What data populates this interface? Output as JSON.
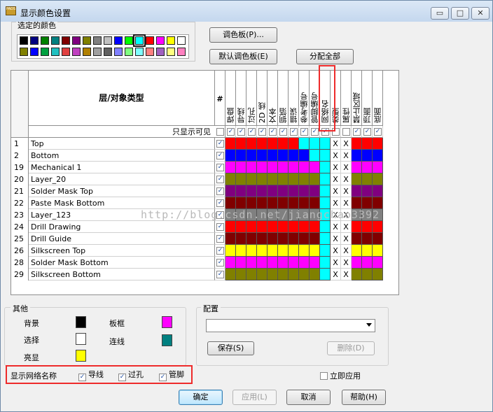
{
  "window": {
    "title": "显示颜色设置",
    "logo_text": "PADS"
  },
  "selected_colors": {
    "label": "选定的颜色",
    "row1": [
      "#000000",
      "#000080",
      "#008000",
      "#008080",
      "#800000",
      "#800080",
      "#808000",
      "#808080",
      "#c0c0c0",
      "#0000ff",
      "#00ff00",
      "#00ffff",
      "#ff0000",
      "#ff00ff",
      "#ffff00",
      "#ffffff"
    ],
    "row2": [
      "#808000",
      "#0000ff",
      "#00a040",
      "#20c0c0",
      "#e04040",
      "#c040c0",
      "#b08000",
      "#a0a0a0",
      "#606060",
      "#8080ff",
      "#80ff80",
      "#80ffff",
      "#ff8080",
      "#a060c0",
      "#ffff80",
      "#ff80c0"
    ],
    "selected_index": 11
  },
  "buttons": {
    "palette": "调色板(P)...",
    "default_palette": "默认调色板(E)",
    "assign_all": "分配全部",
    "save": "保存(S)",
    "delete": "删除(D)",
    "ok": "确定",
    "apply": "应用(L)",
    "cancel": "取消",
    "help": "帮助(H)"
  },
  "grid": {
    "layer_type_header": "层/对象类型",
    "hash_header": "#",
    "visible_only_label": "只显示可见",
    "columns": [
      "焊盘",
      "导线",
      "过孔",
      "2D 线",
      "文本",
      "铜箔",
      "错误",
      "参考编号",
      "管脚编号",
      "网络名",
      "类型",
      "属性",
      "禁止区域",
      "顶面",
      "底面"
    ],
    "rows": [
      {
        "num": "1",
        "name": "Top",
        "colors": [
          "#ff0000",
          "#ff0000",
          "#ff0000",
          "#ff0000",
          "#ff0000",
          "#ff0000",
          "#ff0000",
          "#00ffff",
          "#00ffff",
          "#00ffff",
          "X",
          "X",
          "#ff0000",
          "#ff0000",
          "#ff0000"
        ]
      },
      {
        "num": "2",
        "name": "Bottom",
        "colors": [
          "#0000ff",
          "#0000ff",
          "#0000ff",
          "#0000ff",
          "#0000ff",
          "#0000ff",
          "#0000ff",
          "#0000ff",
          "#00ffff",
          "#00ffff",
          "X",
          "X",
          "#0000ff",
          "#0000ff",
          "#0000ff"
        ]
      },
      {
        "num": "19",
        "name": "Mechanical 1",
        "colors": [
          "#ff00ff",
          "#ff00ff",
          "#ff00ff",
          "#ff00ff",
          "#ff00ff",
          "#ff00ff",
          "#ff00ff",
          "#ff00ff",
          "#ff00ff",
          "#00ffff",
          "X",
          "X",
          "#ff00ff",
          "#ff00ff",
          "#ff00ff"
        ]
      },
      {
        "num": "20",
        "name": "Layer_20",
        "colors": [
          "#808000",
          "#808000",
          "#808000",
          "#808000",
          "#808000",
          "#808000",
          "#808000",
          "#808000",
          "#808000",
          "#00ffff",
          "X",
          "X",
          "#808000",
          "#808000",
          "#808000"
        ]
      },
      {
        "num": "21",
        "name": "Solder Mask Top",
        "colors": [
          "#800080",
          "#800080",
          "#800080",
          "#800080",
          "#800080",
          "#800080",
          "#800080",
          "#800080",
          "#800080",
          "#00ffff",
          "X",
          "X",
          "#800080",
          "#800080",
          "#800080"
        ]
      },
      {
        "num": "22",
        "name": "Paste Mask Bottom",
        "colors": [
          "#800000",
          "#800000",
          "#800000",
          "#800000",
          "#800000",
          "#800000",
          "#800000",
          "#800000",
          "#800000",
          "#00ffff",
          "X",
          "X",
          "#800000",
          "#800000",
          "#800000"
        ]
      },
      {
        "num": "23",
        "name": "Layer_123",
        "colors": [
          "#808080",
          "#808080",
          "#808080",
          "#808080",
          "#808080",
          "#808080",
          "#808080",
          "#808080",
          "#808080",
          "#00ffff",
          "X",
          "X",
          "#808080",
          "#808080",
          "#808080"
        ]
      },
      {
        "num": "24",
        "name": "Drill Drawing",
        "colors": [
          "#ff0000",
          "#ff0000",
          "#ff0000",
          "#ff0000",
          "#ff0000",
          "#ff0000",
          "#ff0000",
          "#ff0000",
          "#ff0000",
          "#00ffff",
          "X",
          "X",
          "#ff0000",
          "#ff0000",
          "#ff0000"
        ]
      },
      {
        "num": "25",
        "name": "Drill Guide",
        "colors": [
          "#800000",
          "#800000",
          "#800000",
          "#800000",
          "#800000",
          "#800000",
          "#800000",
          "#800000",
          "#800000",
          "#00ffff",
          "X",
          "X",
          "#800000",
          "#800000",
          "#800000"
        ]
      },
      {
        "num": "26",
        "name": "Silkscreen Top",
        "colors": [
          "#ffff00",
          "#ffff00",
          "#ffff00",
          "#ffff00",
          "#ffff00",
          "#ffff00",
          "#ffff00",
          "#ffff00",
          "#ffff00",
          "#00ffff",
          "X",
          "X",
          "#ffff00",
          "#ffff00",
          "#ffff00"
        ]
      },
      {
        "num": "28",
        "name": "Solder Mask Bottom",
        "colors": [
          "#ff00ff",
          "#ff00ff",
          "#ff00ff",
          "#ff00ff",
          "#ff00ff",
          "#ff00ff",
          "#ff00ff",
          "#ff00ff",
          "#ff00ff",
          "#00ffff",
          "X",
          "X",
          "#ff00ff",
          "#ff00ff",
          "#ff00ff"
        ]
      },
      {
        "num": "29",
        "name": "Silkscreen Bottom",
        "colors": [
          "#808000",
          "#808000",
          "#808000",
          "#808000",
          "#808000",
          "#808000",
          "#808000",
          "#808000",
          "#808000",
          "#00ffff",
          "X",
          "X",
          "#808000",
          "#808000",
          "#808000"
        ]
      }
    ]
  },
  "watermark": "http://blog.csdn.net/jiangchao3392",
  "other": {
    "label": "其他",
    "background_label": "背景",
    "background_color": "#000000",
    "board_frame_label": "板框",
    "board_frame_color": "#ff00ff",
    "selection_label": "选择",
    "selection_color": "#ffffff",
    "connection_label": "连线",
    "connection_color": "#008080",
    "highlight_label": "亮显",
    "highlight_color": "#ffff00"
  },
  "config": {
    "label": "配置",
    "selected_value": ""
  },
  "net_names": {
    "label": "显示网络名称",
    "traces": "导线",
    "vias": "过孔",
    "pins": "管脚"
  },
  "apply_immediately": "立即应用",
  "check_mark": "✓"
}
